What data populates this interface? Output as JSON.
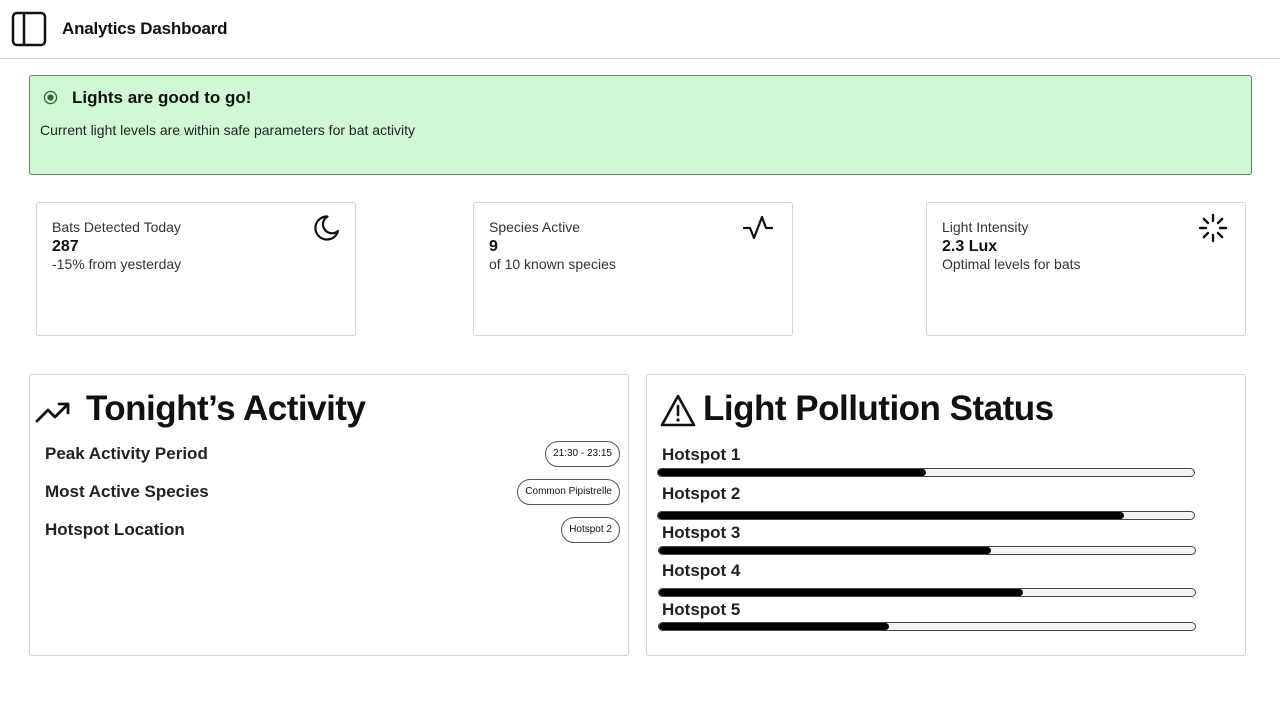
{
  "header": {
    "title": "Analytics Dashboard",
    "toggle_icon": "sidebar-toggle-icon"
  },
  "alert": {
    "title": "Lights are good to go!",
    "description": "Current light levels are within safe parameters for bat activity",
    "color": "#d0f8d4",
    "border_color": "#5a8a5e"
  },
  "stats": [
    {
      "label": "Bats Detected Today",
      "value": "287",
      "sub": "-15% from yesterday",
      "icon": "moon-icon"
    },
    {
      "label": "Species Active",
      "value": "9",
      "sub": "of 10 known species",
      "icon": "activity-pulse-icon"
    },
    {
      "label": "Light Intensity",
      "value": "2.3 Lux",
      "sub": "Optimal levels for bats",
      "icon": "loader-icon"
    }
  ],
  "activity": {
    "title": "Tonight’s Activity",
    "icon": "trending-up-icon",
    "rows": [
      {
        "label": "Peak Activity Period",
        "value": "21:30 - 23:15"
      },
      {
        "label": "Most Active Species",
        "value": "Common Pipistrelle"
      },
      {
        "label": "Hotspot Location",
        "value": "Hotspot 2"
      }
    ]
  },
  "pollution": {
    "title": "Light Pollution Status",
    "icon": "warning-triangle-icon",
    "hotspots": [
      {
        "label": "Hotspot 1",
        "level": 0.5
      },
      {
        "label": "Hotspot 2",
        "level": 0.87
      },
      {
        "label": "Hotspot 3",
        "level": 0.62
      },
      {
        "label": "Hotspot 4",
        "level": 0.68
      },
      {
        "label": "Hotspot 5",
        "level": 0.43
      }
    ]
  }
}
